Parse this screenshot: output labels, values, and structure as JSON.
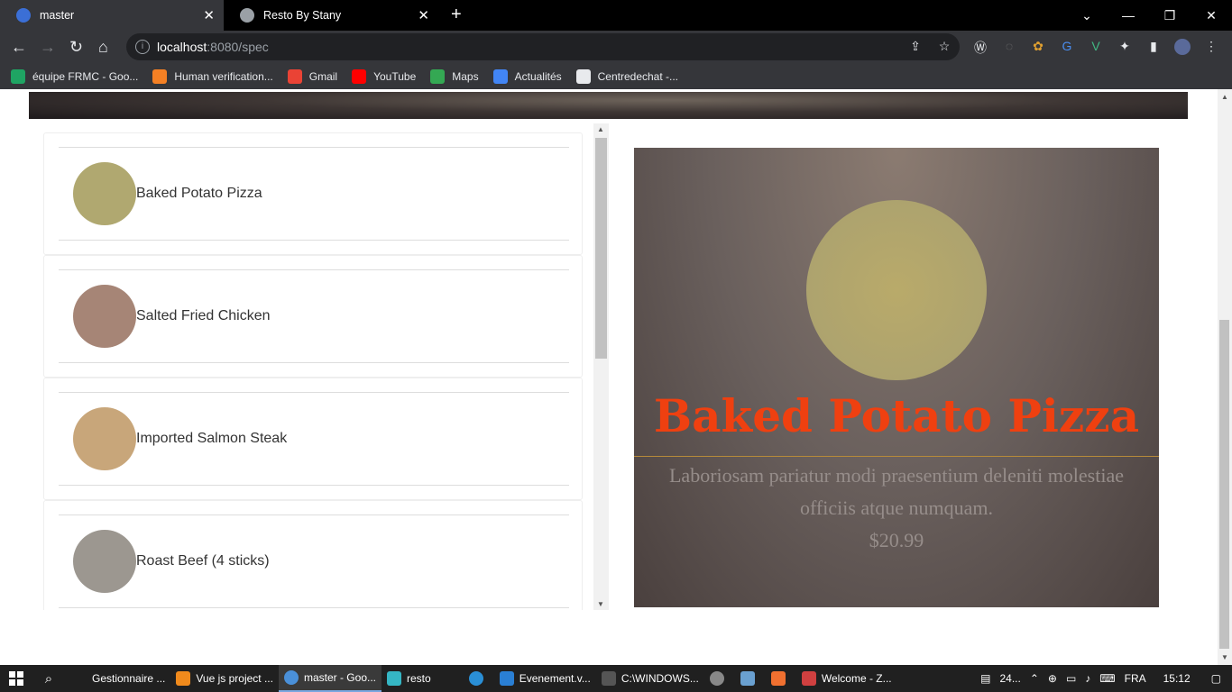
{
  "browser": {
    "tabs": [
      {
        "title": "master",
        "active": true
      },
      {
        "title": "Resto By Stany",
        "active": false
      }
    ],
    "url_host": "localhost",
    "url_path": ":8080/spec",
    "bookmarks": [
      {
        "label": "équipe FRMC - Goo...",
        "icon": "sheets-icon"
      },
      {
        "label": "Human verification...",
        "icon": "stackoverflow-icon"
      },
      {
        "label": "Gmail",
        "icon": "gmail-icon"
      },
      {
        "label": "YouTube",
        "icon": "youtube-icon"
      },
      {
        "label": "Maps",
        "icon": "maps-icon"
      },
      {
        "label": "Actualités",
        "icon": "news-icon"
      },
      {
        "label": "Centredechat -...",
        "icon": "chat-icon"
      }
    ]
  },
  "menu": {
    "items": [
      {
        "name": "Baked Potato Pizza",
        "color": "#b0a870"
      },
      {
        "name": "Salted Fried Chicken",
        "color": "#a68576"
      },
      {
        "name": "Imported Salmon Steak",
        "color": "#c8a67a"
      },
      {
        "name": "Roast Beef (4 sticks)",
        "color": "#9c9790"
      }
    ]
  },
  "detail": {
    "title": "Baked Potato Pizza",
    "description": "Laboriosam pariatur modi praesentium deleniti molestiae officiis atque numquam.",
    "price": "$20.99",
    "title_color": "#ef4010"
  },
  "taskbar": {
    "items": [
      {
        "label": "Gestionnaire ...",
        "icon": "folder-icon",
        "color": "#e8b74a"
      },
      {
        "label": "Vue js project ...",
        "icon": "vlc-icon",
        "color": "#f08a1c"
      },
      {
        "label": "master - Goo...",
        "icon": "chrome-icon",
        "color": "#4a90d9",
        "active": true
      },
      {
        "label": "resto",
        "icon": "folder-icon",
        "color": "#35b6c4"
      },
      {
        "label": "",
        "icon": "edge-icon",
        "color": "#2a8fd6"
      },
      {
        "label": "Evenement.v...",
        "icon": "vscode-icon",
        "color": "#2a7fd4"
      },
      {
        "label": "C:\\WINDOWS...",
        "icon": "cmd-icon",
        "color": "#555"
      },
      {
        "label": "",
        "icon": "media-icon",
        "color": "#888"
      },
      {
        "label": "",
        "icon": "app-icon",
        "color": "#6aa0d0"
      },
      {
        "label": "",
        "icon": "xampp-icon",
        "color": "#f07030"
      },
      {
        "label": "Welcome - Z...",
        "icon": "zend-icon",
        "color": "#d04040"
      }
    ],
    "tray": {
      "news": "24...",
      "lang": "FRA",
      "time": "15:12"
    }
  }
}
